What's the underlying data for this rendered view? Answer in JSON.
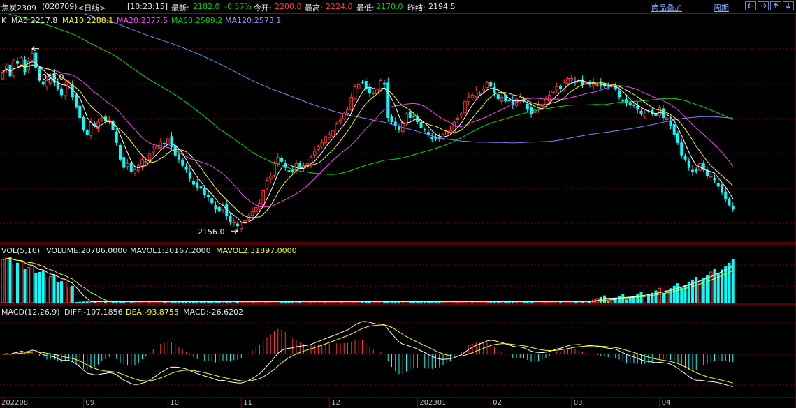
{
  "header": {
    "contract": "焦炭2309",
    "code": "(020709)",
    "period": "<日线>",
    "time": "[10:23:15]",
    "last_label": "最新:",
    "last_value": "2182.0",
    "change_pct": "-0.57%",
    "open_label": "今开:",
    "open_value": "2200.0",
    "high_label": "最高:",
    "high_value": "2224.0",
    "low_label": "最低:",
    "low_value": "2170.0",
    "prev_label": "昨结:",
    "prev_value": "2194.5",
    "overlay_link": "商品叠加",
    "cycle_link": "周期"
  },
  "toolbar": {
    "icons": [
      "arrow-left-icon",
      "arrow-right-icon",
      "arrow-up-icon",
      "arrow-down-icon"
    ]
  },
  "kline_legend": {
    "tag": "K",
    "ma5": "MA5:2217.8",
    "ma10": "MA10:2288.1",
    "ma20": "MA20:2377.5",
    "ma60": "MA60:2589.2",
    "ma120": "MA120:2573.1"
  },
  "vol_legend": {
    "title": "VOL(5,10)",
    "volume": "VOLUME:20786.0000",
    "mavol1": "MAVOL1:30167.2000",
    "mavol2": "MAVOL2:31897.0000"
  },
  "macd_legend": {
    "title": "MACD(12,26,9)",
    "diff": "DIFF:-107.1856",
    "dea": "DEA:-93.8755",
    "macd": "MACD:-26.6202"
  },
  "annotations": {
    "high": "3033.0",
    "low": "2156.0"
  },
  "colors": {
    "up": "#ff3333",
    "down": "#00ffff",
    "ma5": "#ffffff",
    "ma10": "#ffff00",
    "ma20": "#ff40ff",
    "ma60": "#00e000",
    "ma120": "#8080ff",
    "grid": "#800000"
  },
  "chart_data": {
    "type": "candlestick",
    "x_axis_labels": [
      "202208",
      "09",
      "10",
      "11",
      "12",
      "202301",
      "02",
      "03",
      "04"
    ],
    "x_axis_label_index": [
      0,
      22,
      45,
      65,
      89,
      113,
      133,
      155,
      179
    ],
    "count": 200,
    "price_ylim": [
      2100,
      3200
    ],
    "high_point": {
      "index": 8,
      "value": 3033.0
    },
    "low_point": {
      "index": 64,
      "value": 2156.0
    },
    "close": [
      2920,
      2950,
      2900,
      2975,
      2960,
      2990,
      2920,
      2970,
      3010,
      2940,
      2880,
      2860,
      2880,
      2905,
      2870,
      2840,
      2810,
      2860,
      2870,
      2800,
      2750,
      2700,
      2640,
      2620,
      2680,
      2660,
      2680,
      2700,
      2685,
      2690,
      2640,
      2580,
      2500,
      2460,
      2480,
      2440,
      2450,
      2470,
      2500,
      2490,
      2530,
      2550,
      2560,
      2585,
      2575,
      2600,
      2560,
      2520,
      2500,
      2470,
      2450,
      2410,
      2380,
      2365,
      2360,
      2330,
      2320,
      2290,
      2260,
      2250,
      2280,
      2230,
      2200,
      2200,
      2180,
      2185,
      2205,
      2230,
      2250,
      2270,
      2290,
      2350,
      2400,
      2420,
      2480,
      2510,
      2490,
      2460,
      2440,
      2440,
      2480,
      2460,
      2470,
      2480,
      2510,
      2540,
      2560,
      2580,
      2610,
      2620,
      2640,
      2670,
      2690,
      2720,
      2740,
      2800,
      2850,
      2860,
      2870,
      2840,
      2820,
      2820,
      2840,
      2880,
      2860,
      2700,
      2680,
      2660,
      2640,
      2680,
      2720,
      2700,
      2705,
      2680,
      2650,
      2640,
      2620,
      2600,
      2600,
      2600,
      2620,
      2640,
      2640,
      2680,
      2700,
      2720,
      2780,
      2800,
      2810,
      2830,
      2820,
      2840,
      2870,
      2850,
      2820,
      2790,
      2800,
      2780,
      2780,
      2760,
      2790,
      2800,
      2780,
      2740,
      2720,
      2740,
      2760,
      2760,
      2790,
      2810,
      2830,
      2850,
      2840,
      2870,
      2890,
      2890,
      2870,
      2880,
      2860,
      2870,
      2860,
      2870,
      2860,
      2855,
      2850,
      2850,
      2860,
      2840,
      2800,
      2780,
      2770,
      2760,
      2760,
      2740,
      2720,
      2720,
      2730,
      2720,
      2710,
      2750,
      2700,
      2700,
      2660,
      2620,
      2580,
      2520,
      2500,
      2460,
      2440,
      2440,
      2480,
      2450,
      2420,
      2420,
      2400,
      2370,
      2340,
      2310,
      2280,
      2260
    ]
  }
}
